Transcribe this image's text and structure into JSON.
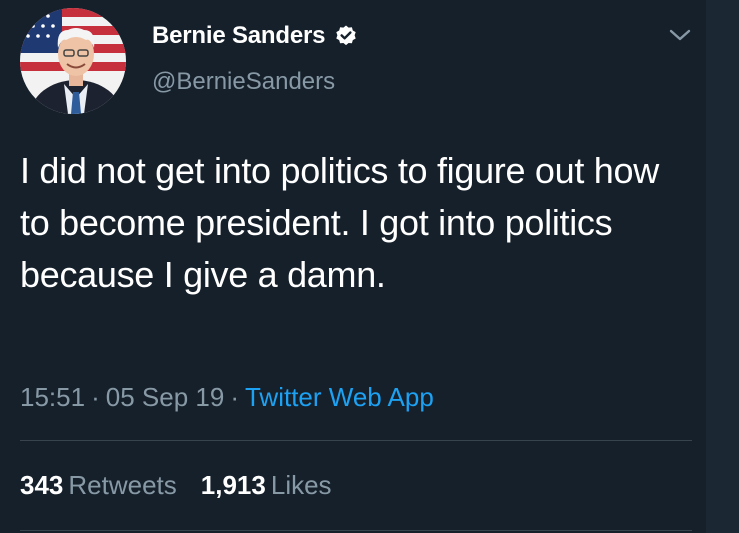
{
  "author": {
    "display_name": "Bernie Sanders",
    "handle": "@BernieSanders",
    "verified_icon": "verified-badge-icon",
    "avatar": "profile-photo"
  },
  "menu": {
    "icon": "chevron-down-icon"
  },
  "tweet": {
    "text": "I did not get into politics to figure out how to become president. I got into politics because I give a damn.",
    "time": "15:51",
    "date": "05 Sep 19",
    "separator": "·",
    "source": "Twitter Web App"
  },
  "stats": {
    "retweets_count": "343",
    "retweets_label": "Retweets",
    "likes_count": "1,913",
    "likes_label": "Likes"
  },
  "colors": {
    "background": "#15202b",
    "text": "#ffffff",
    "muted": "#8899a6",
    "accent": "#1da1f2",
    "divider": "#38444d"
  }
}
